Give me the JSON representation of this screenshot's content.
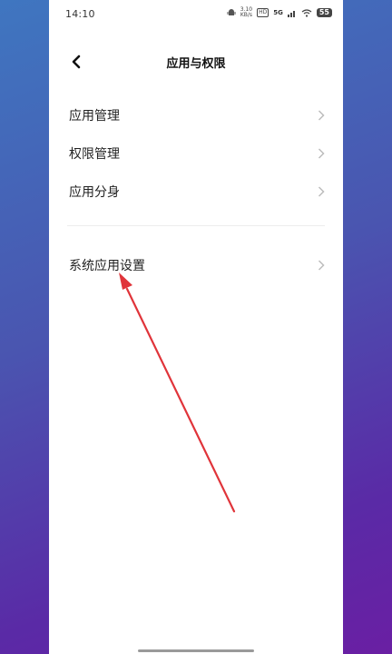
{
  "status_bar": {
    "time": "14:10",
    "net_speed_value": "3.10",
    "net_speed_unit": "KB/s",
    "hd_label": "HD",
    "signal_label": "5G",
    "battery": "55"
  },
  "header": {
    "title": "应用与权限"
  },
  "settings": {
    "items": [
      {
        "label": "应用管理"
      },
      {
        "label": "权限管理"
      },
      {
        "label": "应用分身"
      }
    ],
    "system_items": [
      {
        "label": "系统应用设置"
      }
    ]
  },
  "colors": {
    "annotation_arrow": "#e0343a",
    "background_top": "#3f76c0",
    "background_bottom": "#6a1fa3"
  }
}
